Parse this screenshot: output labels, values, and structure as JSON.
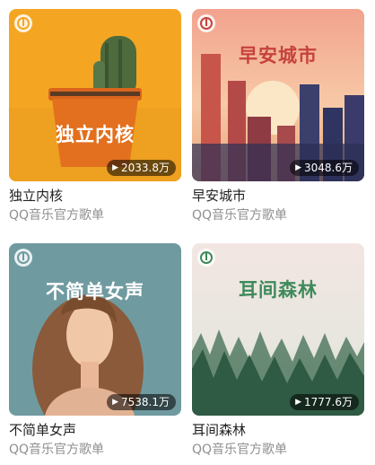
{
  "playlists": [
    {
      "name": "独立内核",
      "cover_title": "独立内核",
      "play_count": "2033.8万",
      "subtitle": "QQ音乐官方歌单"
    },
    {
      "name": "早安城市",
      "cover_title": "早安城市",
      "play_count": "3048.6万",
      "subtitle": "QQ音乐官方歌单"
    },
    {
      "name": "不简单女声",
      "cover_title": "不简单女声",
      "play_count": "7538.1万",
      "subtitle": "QQ音乐官方歌单"
    },
    {
      "name": "耳间森林",
      "cover_title": "耳间森林",
      "play_count": "1777.6万",
      "subtitle": "QQ音乐官方歌单"
    }
  ],
  "icons": {
    "play": "play-icon",
    "logo": "qq-music-logo-icon"
  },
  "colors": {
    "text": "#222222",
    "subtext": "#8f8f8f",
    "badge_bg": "rgba(0,0,0,0.55)"
  }
}
